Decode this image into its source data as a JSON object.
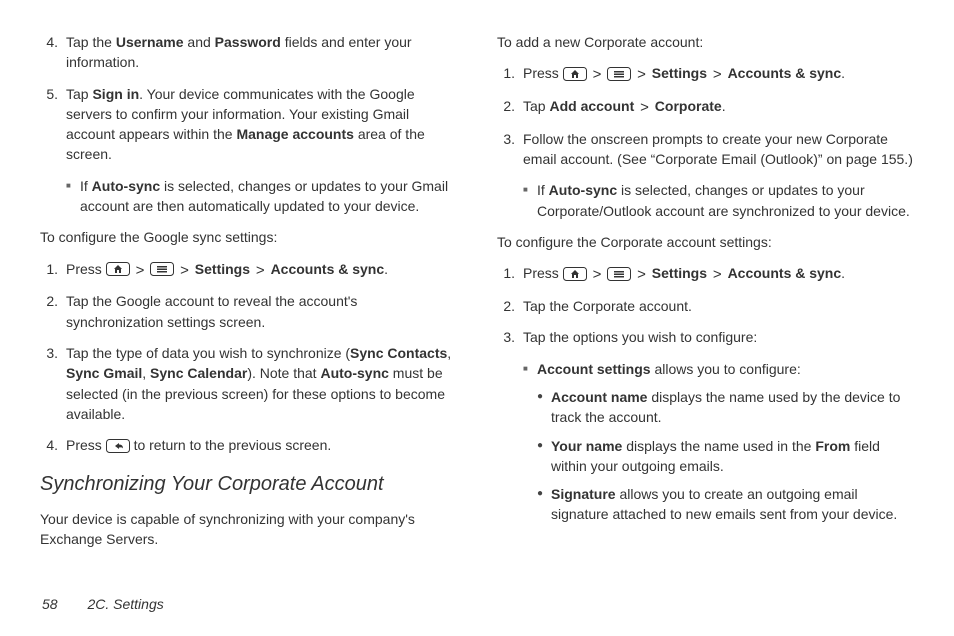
{
  "col1": {
    "step4": {
      "n": "4.",
      "pre": "Tap the ",
      "b1": "Username",
      "mid": " and ",
      "b2": "Password",
      "post": " fields and enter your information."
    },
    "step5": {
      "n": "5.",
      "pre": "Tap ",
      "b1": "Sign in",
      "mid": ". Your device communicates with the Google servers to confirm your information. Your existing Gmail account appears within the ",
      "b2": "Manage accounts",
      "post": " area of the screen."
    },
    "step5sub": {
      "pre": "If ",
      "b1": "Auto-sync",
      "post": " is selected, changes or updates to your Gmail account are then automatically updated to your device."
    },
    "intro1": "To configure the Google sync settings:",
    "g1": {
      "n": "1.",
      "pre": "Press ",
      "b1": "Settings",
      "b2": "Accounts & sync",
      "dot": "."
    },
    "g2": {
      "n": "2.",
      "t": "Tap the Google account to reveal the account's synchronization settings screen."
    },
    "g3": {
      "n": "3.",
      "pre": "Tap the type of data you wish to synchronize (",
      "b1": "Sync Contacts",
      "c1": ", ",
      "b2": "Sync Gmail",
      "c2": ", ",
      "b3": "Sync Calendar",
      "mid": "). Note that ",
      "b4": "Auto-sync",
      "post": " must be selected (in the previous screen) for these options to become available."
    },
    "g4": {
      "n": "4.",
      "pre": "Press ",
      "post": " to return to the previous screen."
    },
    "heading": "Synchronizing Your Corporate Account",
    "hdesc": "Your device is capable of synchronizing with your company's Exchange Servers."
  },
  "col2": {
    "intro1": "To add a new Corporate account:",
    "a1": {
      "n": "1.",
      "pre": "Press ",
      "b1": "Settings",
      "b2": "Accounts & sync",
      "dot": "."
    },
    "a2": {
      "n": "2.",
      "pre": "Tap ",
      "b1": "Add account",
      "b2": "Corporate",
      "dot": "."
    },
    "a3": {
      "n": "3.",
      "t": "Follow the onscreen prompts to create your new Corporate email account. (See “Corporate Email (Outlook)” on page 155.)"
    },
    "a3sub": {
      "pre": "If ",
      "b1": "Auto-sync",
      "post": " is selected, changes or updates to your Corporate/Outlook account are synchronized to your device."
    },
    "intro2": "To configure the Corporate account settings:",
    "c1": {
      "n": "1.",
      "pre": "Press ",
      "b1": "Settings",
      "b2": "Accounts & sync",
      "dot": "."
    },
    "c2": {
      "n": "2.",
      "t": "Tap the Corporate account."
    },
    "c3": {
      "n": "3.",
      "t": "Tap the options you wish to configure:"
    },
    "c3s1": {
      "b1": "Account settings",
      "post": " allows you to configure:"
    },
    "d1": {
      "b1": "Account name",
      "post": " displays the name used by the device to track the account."
    },
    "d2": {
      "b1": "Your name",
      "pre2": " displays the name used in the ",
      "b2": "From",
      "post": " field within your outgoing emails."
    },
    "d3": {
      "b1": "Signature",
      "post": " allows you to create an outgoing email signature attached to new emails sent from your device."
    }
  },
  "footer": {
    "page": "58",
    "section": "2C. Settings"
  }
}
